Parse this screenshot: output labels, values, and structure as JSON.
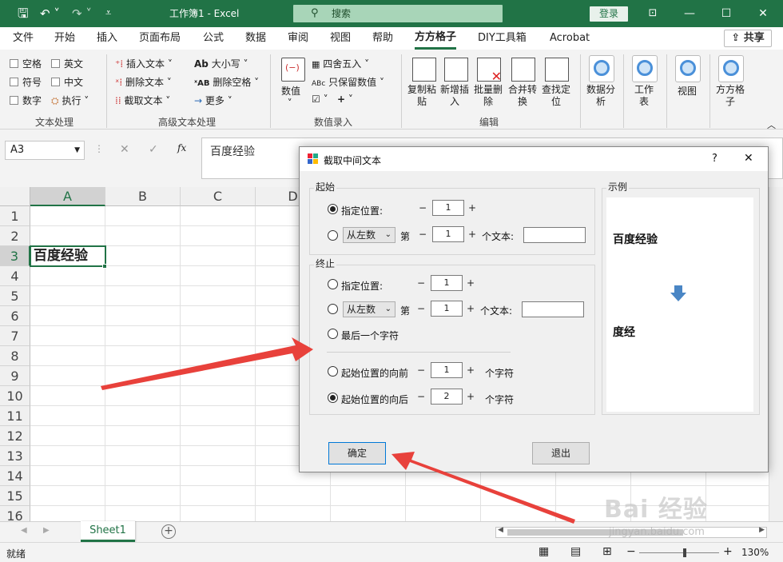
{
  "titlebar": {
    "save_icon": "save-icon",
    "undo_icon": "undo-icon",
    "redo_icon": "redo-icon",
    "title": "工作簿1  -  Excel",
    "search_placeholder": "搜索",
    "login": "登录",
    "ribbon_display_icon": "ribbon-display-icon",
    "minimize_icon": "minimize-icon",
    "restore_icon": "restore-icon",
    "close_icon": "close-icon"
  },
  "menu": {
    "items": [
      "文件",
      "开始",
      "插入",
      "页面布局",
      "公式",
      "数据",
      "审阅",
      "视图",
      "帮助",
      "方方格子",
      "DIY工具箱",
      "Acrobat"
    ],
    "active": "方方格子",
    "share": "共享"
  },
  "ribbon": {
    "text_group": {
      "items": [
        "空格",
        "英文",
        "符号",
        "中文",
        "数字",
        "执行"
      ],
      "label": "文本处理"
    },
    "adv_group": {
      "insert": "插入文本",
      "delete": "删除文本",
      "extract": "截取文本",
      "case": "大小写",
      "del_space": "删除空格",
      "more": "更多",
      "label": "高级文本处理"
    },
    "value_group": {
      "value": "数值",
      "round": "四舍五入",
      "keep": "只保留数值",
      "plus": "+",
      "label": "数值录入"
    },
    "edit_group": {
      "copy_paste": "复制粘\n贴",
      "new_insert": "新增插\n入",
      "batch_delete": "批量删\n除",
      "merge": "合并转\n换",
      "find": "查找定\n位",
      "label": "编辑"
    },
    "right_group": {
      "analysis": "数据分\n析",
      "sheet": "工作\n表",
      "view": "视图",
      "ffgz": "方方格\n子"
    }
  },
  "formula": {
    "namebox": "A3",
    "fx": "fx",
    "content": "百度经验"
  },
  "grid": {
    "columns": [
      "A",
      "B",
      "C",
      "D"
    ],
    "rows": [
      "1",
      "2",
      "3",
      "4",
      "5",
      "6",
      "7",
      "8",
      "9",
      "10",
      "11",
      "12",
      "13",
      "14",
      "15",
      "16"
    ],
    "a3": "百度经验"
  },
  "sheets": {
    "tab": "Sheet1",
    "add": "+"
  },
  "status": {
    "ready": "就绪",
    "zoom": "130%",
    "minus": "−",
    "plus": "+"
  },
  "dialog": {
    "title": "截取中间文本",
    "help": "?",
    "close": "✕",
    "start": {
      "legend": "起始",
      "specified": "指定位置:",
      "specified_value": "1",
      "from_left": "从左数",
      "di": "第",
      "nth_value": "1",
      "text_label": "个文本:"
    },
    "end": {
      "legend": "终止",
      "specified": "指定位置:",
      "specified_value": "1",
      "from_left": "从左数",
      "di": "第",
      "nth_value": "1",
      "text_label": "个文本:",
      "last_char": "最后一个字符",
      "before_start": "起始位置的向前",
      "before_value": "1",
      "after_start": "起始位置的向后",
      "after_value": "2",
      "chars": "个字符"
    },
    "example": {
      "legend": "示例",
      "source": "百度经验",
      "result": "度经"
    },
    "ok": "确定",
    "exit": "退出"
  },
  "watermark": {
    "text": "Bai  经验",
    "url": "jingyan.baidu.com"
  },
  "colors": {
    "excel_green": "#217346",
    "arrow_red": "#e8413b",
    "example_arrow": "#4a86c5"
  }
}
